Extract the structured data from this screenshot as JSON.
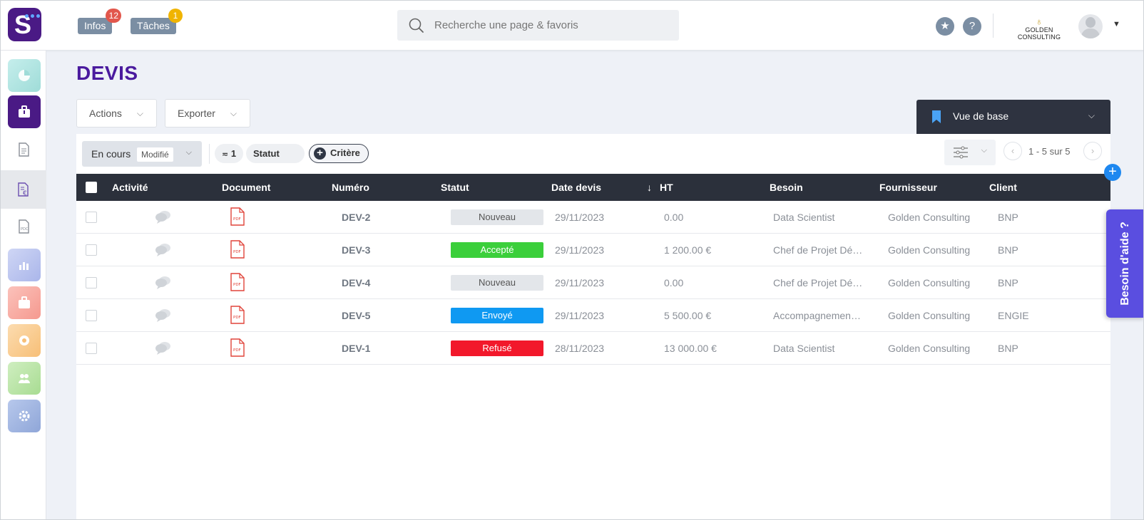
{
  "topbar": {
    "infos_label": "Infos",
    "infos_count": "12",
    "taches_label": "Tâches",
    "taches_count": "1",
    "search_placeholder": "Recherche une page & favoris",
    "company_name": "GOLDEN CONSULTING"
  },
  "page": {
    "title": "DEVIS"
  },
  "toolbar": {
    "actions_label": "Actions",
    "exporter_label": "Exporter"
  },
  "view": {
    "label": "Vue de base"
  },
  "filters": {
    "state_label": "En cours",
    "state_tag": "Modifié",
    "filter_count": "1",
    "status_label": "Statut",
    "add_criterion_label": "Critère"
  },
  "pagination": {
    "info": "1 - 5 sur 5"
  },
  "table": {
    "columns": [
      "Activité",
      "Document",
      "Numéro",
      "Statut",
      "Date devis",
      "↓",
      "HT",
      "Besoin",
      "Fournisseur",
      "Client"
    ],
    "rows": [
      {
        "numero": "DEV-2",
        "statut": "Nouveau",
        "date": "29/11/2023",
        "ht": "0.00",
        "besoin": "Data Scientist",
        "fournisseur": "Golden Consulting",
        "client": "BNP"
      },
      {
        "numero": "DEV-3",
        "statut": "Accepté",
        "date": "29/11/2023",
        "ht": "1 200.00 €",
        "besoin": "Chef de Projet Dé…",
        "fournisseur": "Golden Consulting",
        "client": "BNP"
      },
      {
        "numero": "DEV-4",
        "statut": "Nouveau",
        "date": "29/11/2023",
        "ht": "0.00",
        "besoin": "Chef de Projet Dé…",
        "fournisseur": "Golden Consulting",
        "client": "BNP"
      },
      {
        "numero": "DEV-5",
        "statut": "Envoyé",
        "date": "29/11/2023",
        "ht": "5 500.00 €",
        "besoin": "Accompagnemen…",
        "fournisseur": "Golden Consulting",
        "client": "ENGIE"
      },
      {
        "numero": "DEV-1",
        "statut": "Refusé",
        "date": "28/11/2023",
        "ht": "13 000.00 €",
        "besoin": "Data Scientist",
        "fournisseur": "Golden Consulting",
        "client": "BNP"
      }
    ]
  },
  "status_colors": {
    "Nouveau": "#e3e6ea",
    "Accepté": "#3bcf3b",
    "Envoyé": "#0f99f2",
    "Refusé": "#f2182b"
  },
  "help": {
    "label": "Besoin d'aide ?"
  },
  "icons": [
    "search-icon",
    "star-icon",
    "help-icon",
    "chat-icon",
    "pdf-icon",
    "bookmark-icon",
    "settings-sliders-icon",
    "plus-icon",
    "chevron-down-icon"
  ],
  "colors": {
    "brand": "#4a1a9e",
    "header_dark": "#2b303b",
    "help_tab": "#5a4ee0"
  }
}
